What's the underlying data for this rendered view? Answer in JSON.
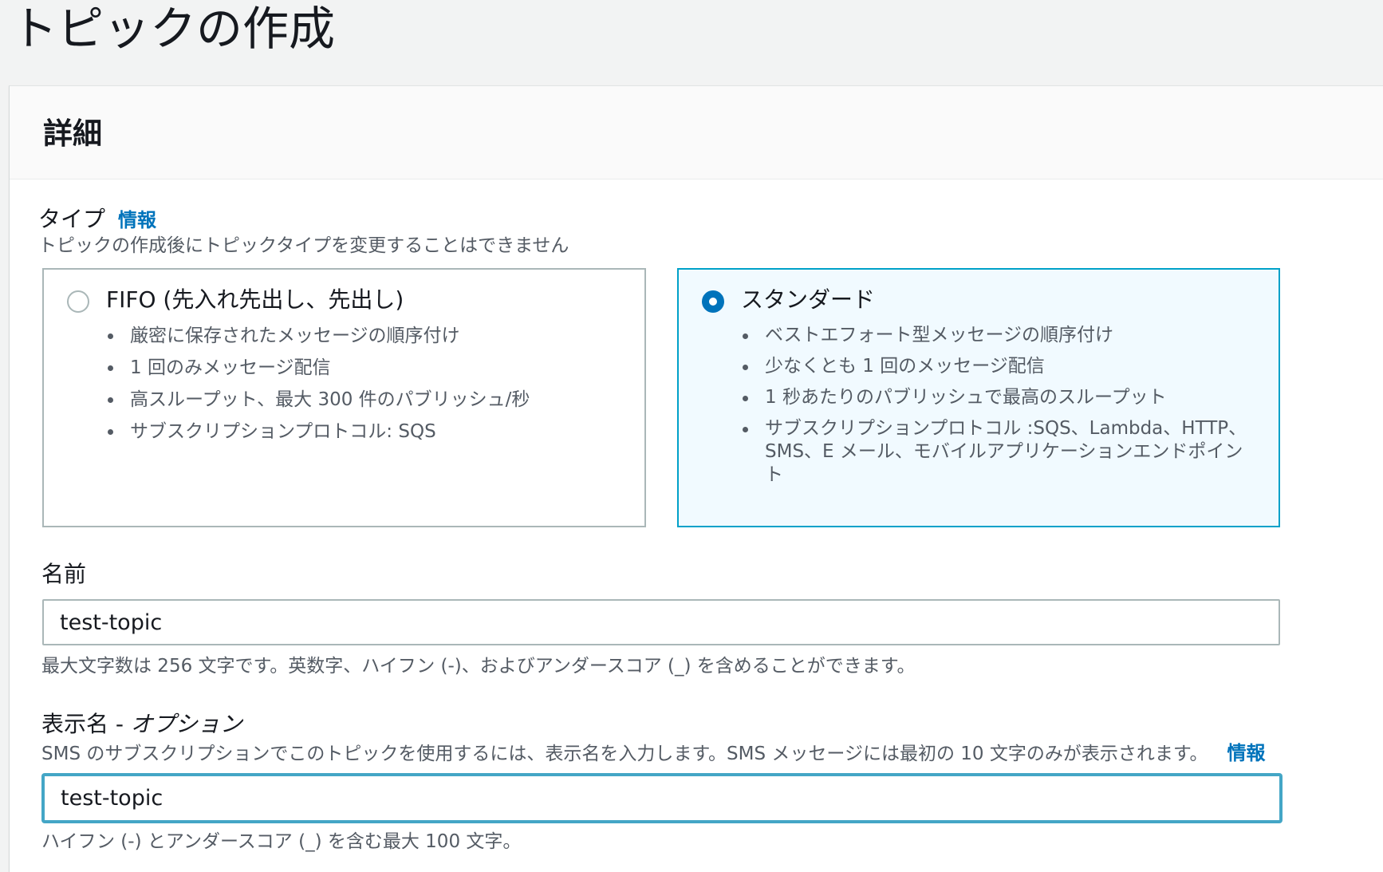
{
  "page": {
    "title": "トピックの作成"
  },
  "details_panel": {
    "title": "詳細"
  },
  "type_field": {
    "label": "タイプ",
    "info_link": "情報",
    "description": "トピックの作成後にトピックタイプを変更することはできません",
    "options": [
      {
        "title": "FIFO (先入れ先出し、先出し)",
        "selected": false,
        "bullets": [
          "厳密に保存されたメッセージの順序付け",
          "1 回のみメッセージ配信",
          "高スループット、最大 300 件のパブリッシュ/秒",
          "サブスクリプションプロトコル: SQS"
        ]
      },
      {
        "title": "スタンダード",
        "selected": true,
        "bullets": [
          "ベストエフォート型メッセージの順序付け",
          "少なくとも 1 回のメッセージ配信",
          "1 秒あたりのパブリッシュで最高のスループット",
          "サブスクリプションプロトコル :SQS、Lambda、HTTP、SMS、E メール、モバイルアプリケーションエンドポイント"
        ]
      }
    ]
  },
  "name_field": {
    "label": "名前",
    "value": "test-topic",
    "hint": "最大文字数は 256 文字です。英数字、ハイフン (-)、およびアンダースコア (_) を含めることができます。"
  },
  "display_name_field": {
    "label": "表示名 - ",
    "label_optional": "オプション",
    "description": "SMS のサブスクリプションでこのトピックを使用するには、表示名を入力します。SMS メッセージには最初の 10 文字のみが表示されます。",
    "info_link": "情報",
    "value": "test-topic",
    "hint": "ハイフン (-) とアンダースコア (_) を含む最大 100 文字。"
  },
  "colors": {
    "link": "#0073bb",
    "selected_border": "#00a1c9",
    "selected_background": "#f1faff",
    "focus_border": "#44a6c6"
  }
}
